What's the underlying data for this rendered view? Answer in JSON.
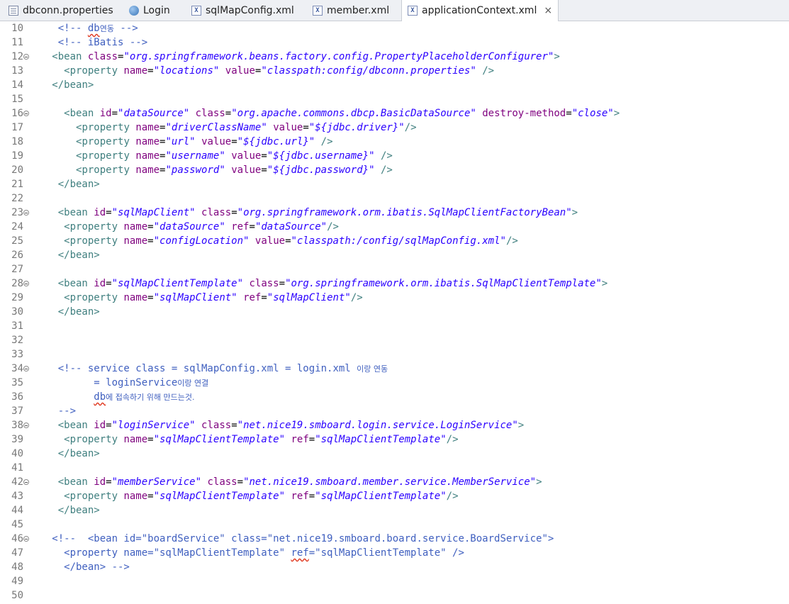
{
  "tabs": [
    {
      "label": "dbconn.properties",
      "icon": "properties-file-icon"
    },
    {
      "label": "Login",
      "icon": "globe-icon"
    },
    {
      "label": "sqlMapConfig.xml",
      "icon": "xml-file-icon"
    },
    {
      "label": "member.xml",
      "icon": "xml-file-icon"
    },
    {
      "label": "applicationContext.xml",
      "icon": "xml-file-icon",
      "active": true,
      "close": "×"
    }
  ],
  "editor": {
    "lines": [
      {
        "n": "10",
        "segs": [
          {
            "t": "    "
          },
          {
            "c": "c",
            "t": "<!-- "
          },
          {
            "c": "c sq",
            "t": "db"
          },
          {
            "c": "c ko",
            "t": "연동"
          },
          {
            "c": "c",
            "t": " -->"
          }
        ]
      },
      {
        "n": "11",
        "segs": [
          {
            "t": "    "
          },
          {
            "c": "c",
            "t": "<!-- iBatis -->"
          }
        ]
      },
      {
        "n": "12",
        "fold": true,
        "segs": [
          {
            "t": "   "
          },
          {
            "c": "t",
            "t": "<bean "
          },
          {
            "c": "a",
            "t": "class"
          },
          {
            "t": "="
          },
          {
            "c": "v",
            "t": "\"org.springframework.beans.factory.config.PropertyPlaceholderConfigurer\""
          },
          {
            "c": "t",
            "t": ">"
          }
        ]
      },
      {
        "n": "13",
        "segs": [
          {
            "t": "     "
          },
          {
            "c": "t",
            "t": "<property "
          },
          {
            "c": "a",
            "t": "name"
          },
          {
            "t": "="
          },
          {
            "c": "v",
            "t": "\"locations\""
          },
          {
            "t": " "
          },
          {
            "c": "a",
            "t": "value"
          },
          {
            "t": "="
          },
          {
            "c": "v",
            "t": "\"classpath:config/dbconn.properties\""
          },
          {
            "t": " "
          },
          {
            "c": "t",
            "t": "/>"
          }
        ]
      },
      {
        "n": "14",
        "segs": [
          {
            "t": "   "
          },
          {
            "c": "t",
            "t": "</bean>"
          }
        ]
      },
      {
        "n": "15",
        "segs": []
      },
      {
        "n": "16",
        "fold": true,
        "segs": [
          {
            "t": "     "
          },
          {
            "c": "t",
            "t": "<bean "
          },
          {
            "c": "a",
            "t": "id"
          },
          {
            "t": "="
          },
          {
            "c": "v",
            "t": "\"dataSource\""
          },
          {
            "t": " "
          },
          {
            "c": "a",
            "t": "class"
          },
          {
            "t": "="
          },
          {
            "c": "v",
            "t": "\"org.apache.commons.dbcp.BasicDataSource\""
          },
          {
            "t": " "
          },
          {
            "c": "a",
            "t": "destroy-method"
          },
          {
            "t": "="
          },
          {
            "c": "v",
            "t": "\"close\""
          },
          {
            "c": "t",
            "t": ">"
          }
        ]
      },
      {
        "n": "17",
        "segs": [
          {
            "t": "       "
          },
          {
            "c": "t",
            "t": "<property "
          },
          {
            "c": "a",
            "t": "name"
          },
          {
            "t": "="
          },
          {
            "c": "v",
            "t": "\"driverClassName\""
          },
          {
            "t": " "
          },
          {
            "c": "a",
            "t": "value"
          },
          {
            "t": "="
          },
          {
            "c": "v",
            "t": "\"${jdbc.driver}\""
          },
          {
            "c": "t",
            "t": "/>"
          }
        ]
      },
      {
        "n": "18",
        "segs": [
          {
            "t": "       "
          },
          {
            "c": "t",
            "t": "<property "
          },
          {
            "c": "a",
            "t": "name"
          },
          {
            "t": "="
          },
          {
            "c": "v",
            "t": "\"url\""
          },
          {
            "t": " "
          },
          {
            "c": "a",
            "t": "value"
          },
          {
            "t": "="
          },
          {
            "c": "v",
            "t": "\"${jdbc.url}\""
          },
          {
            "t": " "
          },
          {
            "c": "t",
            "t": "/>"
          }
        ]
      },
      {
        "n": "19",
        "segs": [
          {
            "t": "       "
          },
          {
            "c": "t",
            "t": "<property "
          },
          {
            "c": "a",
            "t": "name"
          },
          {
            "t": "="
          },
          {
            "c": "v",
            "t": "\"username\""
          },
          {
            "t": " "
          },
          {
            "c": "a",
            "t": "value"
          },
          {
            "t": "="
          },
          {
            "c": "v",
            "t": "\"${jdbc.username}\""
          },
          {
            "t": " "
          },
          {
            "c": "t",
            "t": "/>"
          }
        ]
      },
      {
        "n": "20",
        "segs": [
          {
            "t": "       "
          },
          {
            "c": "t",
            "t": "<property "
          },
          {
            "c": "a",
            "t": "name"
          },
          {
            "t": "="
          },
          {
            "c": "v",
            "t": "\"password\""
          },
          {
            "t": " "
          },
          {
            "c": "a",
            "t": "value"
          },
          {
            "t": "="
          },
          {
            "c": "v",
            "t": "\"${jdbc.password}\""
          },
          {
            "t": " "
          },
          {
            "c": "t",
            "t": "/>"
          }
        ]
      },
      {
        "n": "21",
        "segs": [
          {
            "t": "    "
          },
          {
            "c": "t",
            "t": "</bean>"
          }
        ]
      },
      {
        "n": "22",
        "segs": []
      },
      {
        "n": "23",
        "fold": true,
        "segs": [
          {
            "t": "    "
          },
          {
            "c": "t",
            "t": "<bean "
          },
          {
            "c": "a",
            "t": "id"
          },
          {
            "t": "="
          },
          {
            "c": "v",
            "t": "\"sqlMapClient\""
          },
          {
            "t": " "
          },
          {
            "c": "a",
            "t": "class"
          },
          {
            "t": "="
          },
          {
            "c": "v",
            "t": "\"org.springframework.orm.ibatis.SqlMapClientFactoryBean\""
          },
          {
            "c": "t",
            "t": ">"
          }
        ]
      },
      {
        "n": "24",
        "segs": [
          {
            "t": "     "
          },
          {
            "c": "t",
            "t": "<property "
          },
          {
            "c": "a",
            "t": "name"
          },
          {
            "t": "="
          },
          {
            "c": "v",
            "t": "\"dataSource\""
          },
          {
            "t": " "
          },
          {
            "c": "a",
            "t": "ref"
          },
          {
            "t": "="
          },
          {
            "c": "v",
            "t": "\"dataSource\""
          },
          {
            "c": "t",
            "t": "/>"
          }
        ]
      },
      {
        "n": "25",
        "segs": [
          {
            "t": "     "
          },
          {
            "c": "t",
            "t": "<property "
          },
          {
            "c": "a",
            "t": "name"
          },
          {
            "t": "="
          },
          {
            "c": "v",
            "t": "\"configLocation\""
          },
          {
            "t": " "
          },
          {
            "c": "a",
            "t": "value"
          },
          {
            "t": "="
          },
          {
            "c": "v",
            "t": "\"classpath:/config/sqlMapConfig.xml\""
          },
          {
            "c": "t",
            "t": "/>"
          }
        ]
      },
      {
        "n": "26",
        "segs": [
          {
            "t": "    "
          },
          {
            "c": "t",
            "t": "</bean>"
          }
        ]
      },
      {
        "n": "27",
        "segs": []
      },
      {
        "n": "28",
        "fold": true,
        "segs": [
          {
            "t": "    "
          },
          {
            "c": "t",
            "t": "<bean "
          },
          {
            "c": "a",
            "t": "id"
          },
          {
            "t": "="
          },
          {
            "c": "v",
            "t": "\"sqlMapClientTemplate\""
          },
          {
            "t": " "
          },
          {
            "c": "a",
            "t": "class"
          },
          {
            "t": "="
          },
          {
            "c": "v",
            "t": "\"org.springframework.orm.ibatis.SqlMapClientTemplate\""
          },
          {
            "c": "t",
            "t": ">"
          }
        ]
      },
      {
        "n": "29",
        "segs": [
          {
            "t": "     "
          },
          {
            "c": "t",
            "t": "<property "
          },
          {
            "c": "a",
            "t": "name"
          },
          {
            "t": "="
          },
          {
            "c": "v",
            "t": "\"sqlMapClient\""
          },
          {
            "t": " "
          },
          {
            "c": "a",
            "t": "ref"
          },
          {
            "t": "="
          },
          {
            "c": "v",
            "t": "\"sqlMapClient\""
          },
          {
            "c": "t",
            "t": "/>"
          }
        ]
      },
      {
        "n": "30",
        "segs": [
          {
            "t": "    "
          },
          {
            "c": "t",
            "t": "</bean>"
          }
        ]
      },
      {
        "n": "31",
        "segs": []
      },
      {
        "n": "32",
        "segs": []
      },
      {
        "n": "33",
        "segs": []
      },
      {
        "n": "34",
        "fold": true,
        "segs": [
          {
            "t": "    "
          },
          {
            "c": "c",
            "t": "<!-- service class = sqlMapConfig.xml = login.xml "
          },
          {
            "c": "c ko",
            "t": "이랑 연동"
          }
        ]
      },
      {
        "n": "35",
        "segs": [
          {
            "c": "c",
            "t": "          = loginService"
          },
          {
            "c": "c ko",
            "t": "이랑 연결"
          }
        ]
      },
      {
        "n": "36",
        "segs": [
          {
            "t": "          "
          },
          {
            "c": "c sq",
            "t": "db"
          },
          {
            "c": "c ko",
            "t": "에 접속하기 위해 만드는것."
          }
        ]
      },
      {
        "n": "37",
        "segs": [
          {
            "t": "    "
          },
          {
            "c": "c",
            "t": "-->"
          }
        ]
      },
      {
        "n": "38",
        "fold": true,
        "segs": [
          {
            "t": "    "
          },
          {
            "c": "t",
            "t": "<bean "
          },
          {
            "c": "a",
            "t": "id"
          },
          {
            "t": "="
          },
          {
            "c": "v",
            "t": "\"loginService\""
          },
          {
            "t": " "
          },
          {
            "c": "a",
            "t": "class"
          },
          {
            "t": "="
          },
          {
            "c": "v",
            "t": "\"net.nice19.smboard.login.service.LoginService\""
          },
          {
            "c": "t",
            "t": ">"
          }
        ]
      },
      {
        "n": "39",
        "segs": [
          {
            "t": "     "
          },
          {
            "c": "t",
            "t": "<property "
          },
          {
            "c": "a",
            "t": "name"
          },
          {
            "t": "="
          },
          {
            "c": "v",
            "t": "\"sqlMapClientTemplate\""
          },
          {
            "t": " "
          },
          {
            "c": "a",
            "t": "ref"
          },
          {
            "t": "="
          },
          {
            "c": "v",
            "t": "\"sqlMapClientTemplate\""
          },
          {
            "c": "t",
            "t": "/>"
          }
        ]
      },
      {
        "n": "40",
        "segs": [
          {
            "t": "    "
          },
          {
            "c": "t",
            "t": "</bean>"
          }
        ]
      },
      {
        "n": "41",
        "segs": []
      },
      {
        "n": "42",
        "fold": true,
        "segs": [
          {
            "t": "    "
          },
          {
            "c": "t",
            "t": "<bean "
          },
          {
            "c": "a",
            "t": "id"
          },
          {
            "t": "="
          },
          {
            "c": "v",
            "t": "\"memberService\""
          },
          {
            "t": " "
          },
          {
            "c": "a",
            "t": "class"
          },
          {
            "t": "="
          },
          {
            "c": "v",
            "t": "\"net.nice19.smboard.member.service.MemberService\""
          },
          {
            "c": "t",
            "t": ">"
          }
        ]
      },
      {
        "n": "43",
        "segs": [
          {
            "t": "     "
          },
          {
            "c": "t",
            "t": "<property "
          },
          {
            "c": "a",
            "t": "name"
          },
          {
            "t": "="
          },
          {
            "c": "v",
            "t": "\"sqlMapClientTemplate\""
          },
          {
            "t": " "
          },
          {
            "c": "a",
            "t": "ref"
          },
          {
            "t": "="
          },
          {
            "c": "v",
            "t": "\"sqlMapClientTemplate\""
          },
          {
            "c": "t",
            "t": "/>"
          }
        ]
      },
      {
        "n": "44",
        "segs": [
          {
            "t": "    "
          },
          {
            "c": "t",
            "t": "</bean>"
          }
        ]
      },
      {
        "n": "45",
        "segs": []
      },
      {
        "n": "46",
        "fold": true,
        "segs": [
          {
            "t": "   "
          },
          {
            "c": "c",
            "t": "<!--  <bean id=\"boardService\" class=\"net.nice19.smboard.board.service.BoardService\">"
          }
        ]
      },
      {
        "n": "47",
        "segs": [
          {
            "c": "c",
            "t": "     <property name=\"sqlMapClientTemplate\" "
          },
          {
            "c": "c sq",
            "t": "ref"
          },
          {
            "c": "c",
            "t": "=\"sqlMapClientTemplate\" />"
          }
        ]
      },
      {
        "n": "48",
        "segs": [
          {
            "c": "c",
            "t": "     </bean> -->"
          }
        ]
      },
      {
        "n": "49",
        "segs": []
      },
      {
        "n": "50",
        "segs": []
      }
    ]
  }
}
